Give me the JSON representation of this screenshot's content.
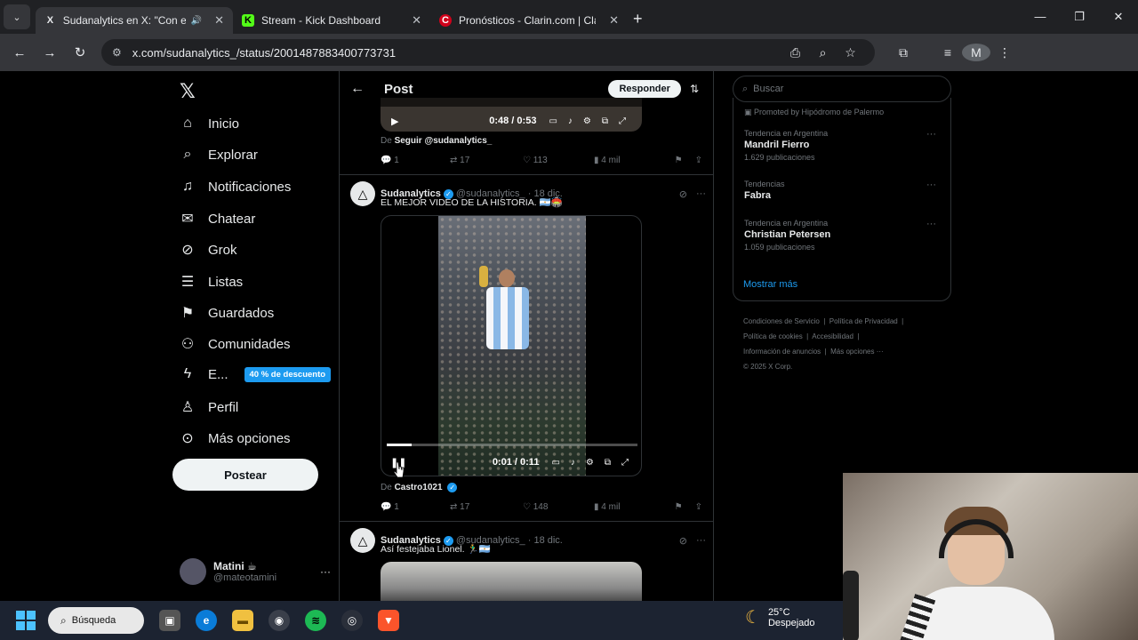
{
  "browser": {
    "tabs": [
      {
        "title": "Sudanalytics en X: \"Con ese",
        "favicon": "X",
        "active": true
      },
      {
        "title": "Stream - Kick Dashboard",
        "favicon": "K",
        "active": false
      },
      {
        "title": "Pronósticos - Clarin.com | Clarín",
        "favicon": "C",
        "active": false
      }
    ],
    "url": "x.com/sudanalytics_/status/2001487883400773731",
    "profile_initial": "M"
  },
  "nav": {
    "items": [
      {
        "label": "Inicio",
        "icon": "home-icon"
      },
      {
        "label": "Explorar",
        "icon": "search-icon"
      },
      {
        "label": "Notificaciones",
        "icon": "bell-icon"
      },
      {
        "label": "Chatear",
        "icon": "mail-icon"
      },
      {
        "label": "Grok",
        "icon": "grok-icon"
      },
      {
        "label": "Listas",
        "icon": "list-icon"
      },
      {
        "label": "Guardados",
        "icon": "bookmark-icon"
      },
      {
        "label": "Comunidades",
        "icon": "people-icon"
      },
      {
        "label": "E...",
        "icon": "bolt-icon",
        "badge": "40 % de descuento"
      },
      {
        "label": "Perfil",
        "icon": "user-icon"
      },
      {
        "label": "Más opciones",
        "icon": "more-circle-icon"
      }
    ],
    "post_button": "Postear",
    "profile": {
      "name": "Matini ☕",
      "handle": "@mateotamini"
    }
  },
  "main": {
    "header_title": "Post",
    "reply_button": "Responder",
    "top_video": {
      "time": "0:48 / 0:53",
      "source_prefix": "De",
      "source_name": "Seguir @sudanalytics_"
    },
    "top_actions": {
      "replies": "1",
      "reposts": "17",
      "likes": "113",
      "views": "4 mil"
    },
    "tweet1": {
      "name": "Sudanalytics",
      "handle": "@sudanalytics_ · 18 dic.",
      "text": "EL MEJOR VIDEO DE LA HISTORIA. 🇦🇷🏟️",
      "video_time": "0:01 / 0:11",
      "video_progress": 0.1,
      "source_prefix": "De",
      "source_name": "Castro1021",
      "actions": {
        "replies": "1",
        "reposts": "17",
        "likes": "148",
        "views": "4 mil"
      }
    },
    "tweet2": {
      "name": "Sudanalytics",
      "handle": "@sudanalytics_ · 18 dic.",
      "text": "Así festejaba Lionel. 🏃‍♂️🇦🇷"
    }
  },
  "right": {
    "search_placeholder": "Buscar",
    "promoted": "Promoted by Hipódromo de Palermo",
    "trends": [
      {
        "context": "Tendencia en Argentina",
        "name": "Mandril Fierro",
        "count": "1.629 publicaciones"
      },
      {
        "context": "Tendencias",
        "name": "Fabra",
        "count": ""
      },
      {
        "context": "Tendencia en Argentina",
        "name": "Christian Petersen",
        "count": "1.059 publicaciones"
      }
    ],
    "show_more": "Mostrar más",
    "footer": [
      "Condiciones de Servicio",
      "Política de Privacidad",
      "Política de cookies",
      "Accesibilidad",
      "Información de anuncios",
      "Más opciones ···",
      "© 2025 X Corp."
    ]
  },
  "taskbar": {
    "search_label": "Búsqueda",
    "temperature": "25°C",
    "condition": "Despejado"
  }
}
